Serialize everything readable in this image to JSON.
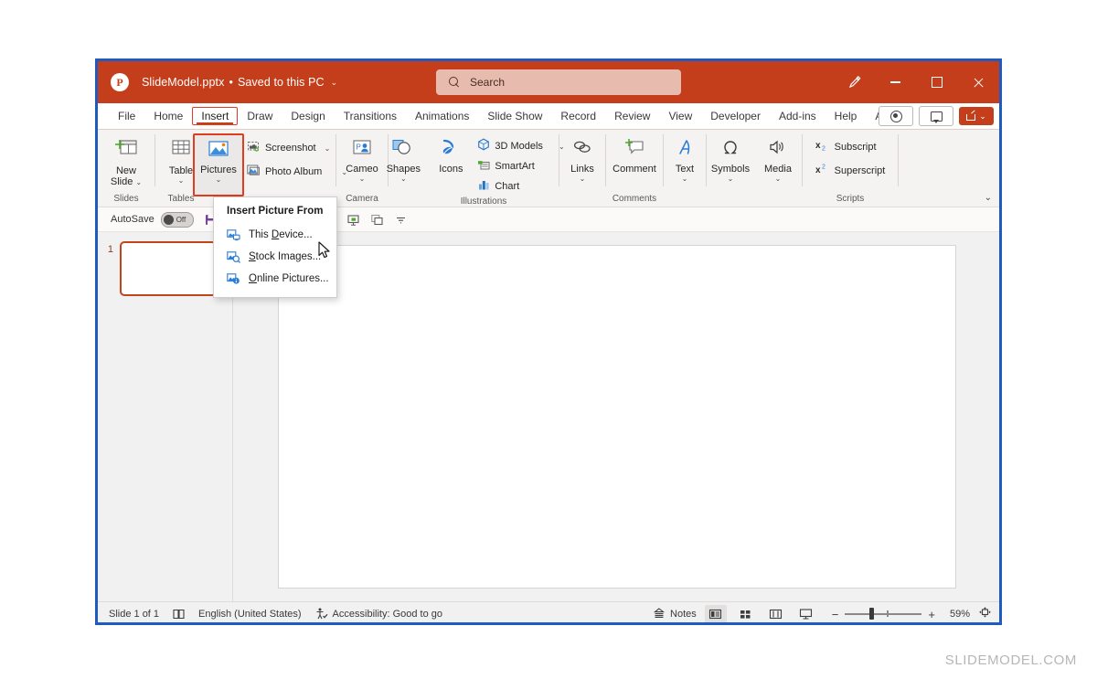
{
  "app": {
    "logo_icon": "powerpoint-logo",
    "title": "SlideModel.pptx",
    "separator": "•",
    "save_state": "Saved to this PC",
    "chevron": "⌄"
  },
  "search": {
    "placeholder": "Search",
    "icon": "search-icon"
  },
  "window_controls": {
    "pen_icon": "pen-icon",
    "minimize": "minimize-icon",
    "maximize": "maximize-icon",
    "close": "close-icon"
  },
  "tabs": [
    {
      "label": "File",
      "active": false
    },
    {
      "label": "Home",
      "active": false
    },
    {
      "label": "Insert",
      "active": true
    },
    {
      "label": "Draw",
      "active": false
    },
    {
      "label": "Design",
      "active": false
    },
    {
      "label": "Transitions",
      "active": false
    },
    {
      "label": "Animations",
      "active": false
    },
    {
      "label": "Slide Show",
      "active": false
    },
    {
      "label": "Record",
      "active": false
    },
    {
      "label": "Review",
      "active": false
    },
    {
      "label": "View",
      "active": false
    },
    {
      "label": "Developer",
      "active": false
    },
    {
      "label": "Add-ins",
      "active": false
    },
    {
      "label": "Help",
      "active": false
    },
    {
      "label": "Acrobat",
      "active": false
    }
  ],
  "tab_right": {
    "record_icon": "record-icon",
    "comment_icon": "comment-icon",
    "share_icon": "share-icon",
    "share_chevron": "⌄"
  },
  "ribbon": {
    "collapse_icon": "collapse-ribbon-chevron-icon",
    "groups": [
      {
        "name": "Slides",
        "label": "Slides",
        "items": [
          {
            "label": "New Slide",
            "icon": "new-slide-icon",
            "chevron": "⌄"
          }
        ]
      },
      {
        "name": "Tables",
        "label": "Tables",
        "items": [
          {
            "label": "Table",
            "icon": "table-icon",
            "chevron": "⌄"
          }
        ]
      },
      {
        "name": "Images",
        "label": "",
        "items": [
          {
            "label": "Pictures",
            "icon": "pictures-icon",
            "chevron": "⌄",
            "highlighted": true
          },
          {
            "label": "Screenshot",
            "icon": "screenshot-icon",
            "chevron": "⌄"
          },
          {
            "label": "Photo Album",
            "icon": "photo-album-icon",
            "chevron": "⌄"
          }
        ]
      },
      {
        "name": "Camera",
        "label": "Camera",
        "items": [
          {
            "label": "Cameo",
            "icon": "cameo-icon",
            "chevron": "⌄"
          }
        ]
      },
      {
        "name": "Illustrations",
        "label": "Illustrations",
        "items": [
          {
            "label": "Shapes",
            "icon": "shapes-icon",
            "chevron": "⌄"
          },
          {
            "label": "Icons",
            "icon": "icons-icon",
            "chevron": ""
          },
          {
            "label": "3D Models",
            "icon": "3d-models-icon",
            "chevron": "⌄"
          },
          {
            "label": "SmartArt",
            "icon": "smartart-icon",
            "chevron": ""
          },
          {
            "label": "Chart",
            "icon": "chart-icon",
            "chevron": ""
          }
        ]
      },
      {
        "name": "Links",
        "label": "",
        "items": [
          {
            "label": "Links",
            "icon": "links-icon",
            "chevron": "⌄"
          }
        ]
      },
      {
        "name": "Comments",
        "label": "Comments",
        "items": [
          {
            "label": "Comment",
            "icon": "comment-balloon-icon",
            "chevron": ""
          }
        ]
      },
      {
        "name": "Text",
        "label": "",
        "items": [
          {
            "label": "Text",
            "icon": "text-icon",
            "chevron": "⌄"
          }
        ]
      },
      {
        "name": "Symbols",
        "label": "",
        "items": [
          {
            "label": "Symbols",
            "icon": "omega-icon",
            "chevron": "⌄"
          },
          {
            "label": "Media",
            "icon": "media-speaker-icon",
            "chevron": "⌄"
          }
        ]
      },
      {
        "name": "Scripts",
        "label": "Scripts",
        "items": [
          {
            "label": "Subscript",
            "icon": "subscript-icon",
            "chevron": ""
          },
          {
            "label": "Superscript",
            "icon": "superscript-icon",
            "chevron": ""
          }
        ]
      }
    ]
  },
  "quick_access": {
    "autosave_label": "AutoSave",
    "autosave_state": "Off",
    "icons": [
      "save-icon",
      "undo-icon",
      "redo-icon",
      "start-from-beginning-icon",
      "email-icon",
      "print-preview-icon",
      "present-icon",
      "duplicate-icon",
      "more-commands-icon"
    ]
  },
  "dropdown": {
    "title": "Insert Picture From",
    "items": [
      {
        "label": "This Device...",
        "icon": "this-device-icon",
        "accel": "D"
      },
      {
        "label": "Stock Images...",
        "icon": "stock-images-icon",
        "accel": "S"
      },
      {
        "label": "Online Pictures...",
        "icon": "online-pictures-icon",
        "accel": "O"
      }
    ]
  },
  "slides_pane": {
    "slides": [
      {
        "number": "1"
      }
    ]
  },
  "status_bar": {
    "slide_count": "Slide 1 of 1",
    "notes_page_icon": "notes-page-icon",
    "language": "English (United States)",
    "accessibility_icon": "accessibility-icon",
    "accessibility": "Accessibility: Good to go",
    "notes_label": "Notes",
    "notes_icon": "notes-icon",
    "view_normal_icon": "normal-view-icon",
    "view_sorter_icon": "slide-sorter-icon",
    "view_reading_icon": "reading-view-icon",
    "view_slideshow_icon": "slide-show-icon",
    "zoom_out": "−",
    "zoom_in": "+",
    "zoom_level": "59%",
    "fit_icon": "fit-slide-icon"
  },
  "watermark": "SLIDEMODEL.COM",
  "colors": {
    "brand": "#c43e1c",
    "window_border": "#1f5bbf",
    "highlight": "#e03c1f",
    "accent_blue": "#2b7cd3"
  }
}
